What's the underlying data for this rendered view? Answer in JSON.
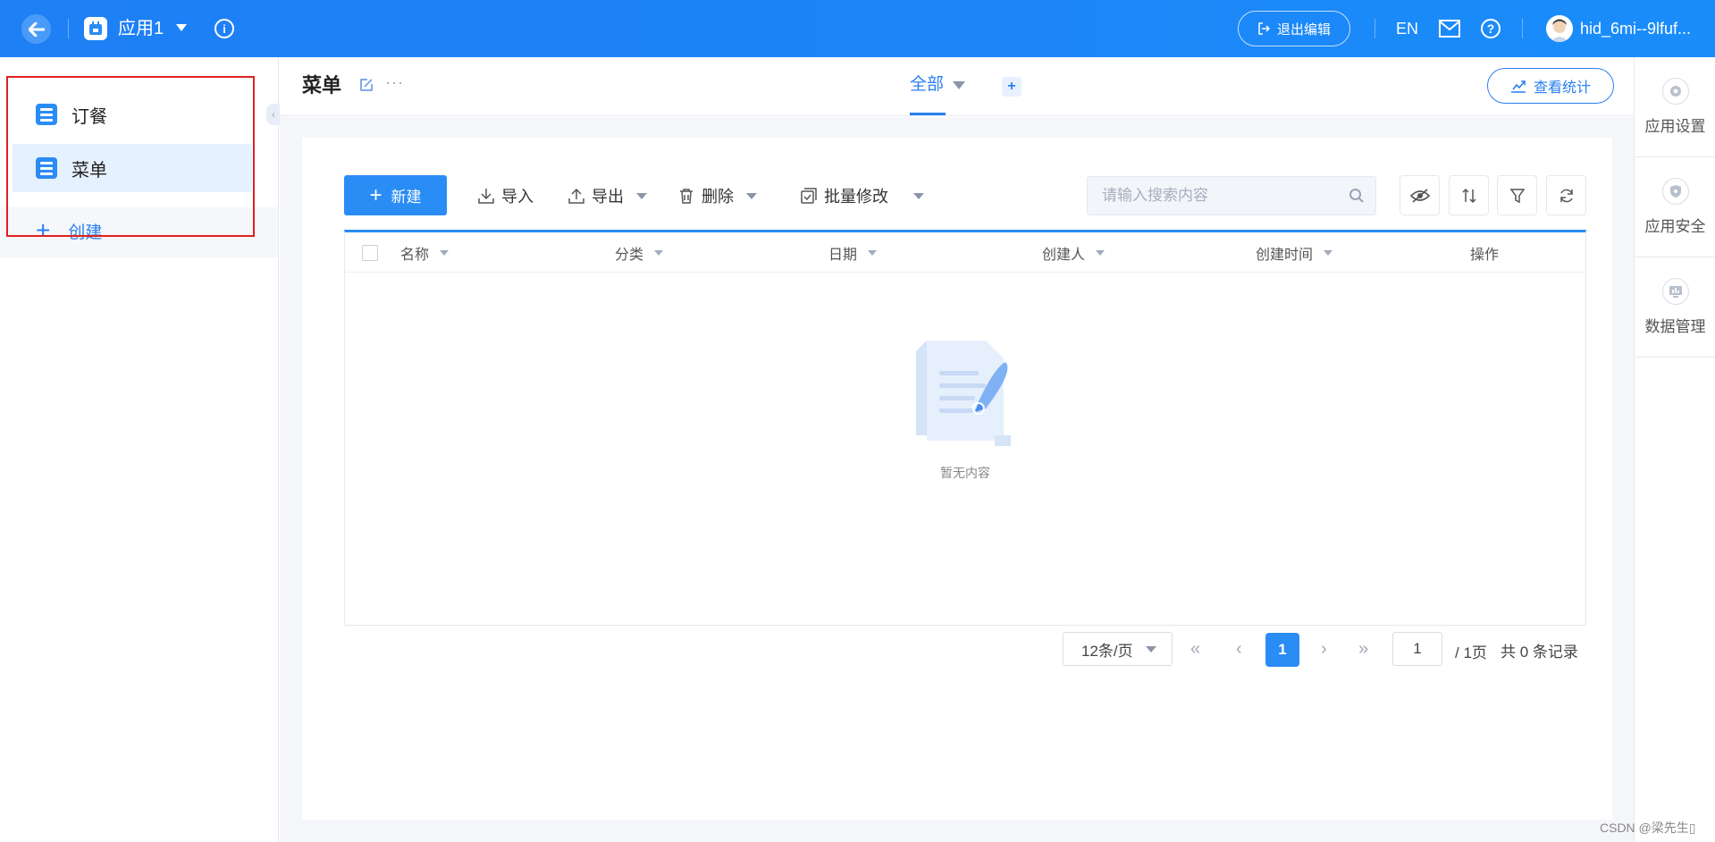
{
  "topbar": {
    "app_name": "应用1",
    "exit_edit_label": "退出编辑",
    "language": "EN",
    "user_name": "hid_6mi--9lfuf..."
  },
  "sidebar": {
    "items": [
      {
        "label": "订餐",
        "active": false
      },
      {
        "label": "菜单",
        "active": true
      }
    ],
    "create_label": "创建"
  },
  "header": {
    "title": "菜单",
    "view_tab": "全部",
    "stats_button": "查看统计"
  },
  "right_panel": {
    "items": [
      {
        "label": "应用设置",
        "icon": "gear-icon"
      },
      {
        "label": "应用安全",
        "icon": "shield-icon"
      },
      {
        "label": "数据管理",
        "icon": "data-icon"
      }
    ]
  },
  "toolbar": {
    "new_label": "新建",
    "import_label": "导入",
    "export_label": "导出",
    "delete_label": "删除",
    "batch_edit_label": "批量修改",
    "search_placeholder": "请输入搜索内容"
  },
  "table": {
    "columns": [
      "名称",
      "分类",
      "日期",
      "创建人",
      "创建时间",
      "操作"
    ],
    "empty_text": "暂无内容"
  },
  "pagination": {
    "page_size": "12条/页",
    "current_page": "1",
    "page_input": "1",
    "total_pages": "/ 1页",
    "record_count": "共 0 条记录"
  },
  "watermark": "CSDN @梁先生▯",
  "colors": {
    "primary": "#2a8cf5",
    "topbar": "#1f7ff5",
    "highlight_box": "#e02020"
  }
}
